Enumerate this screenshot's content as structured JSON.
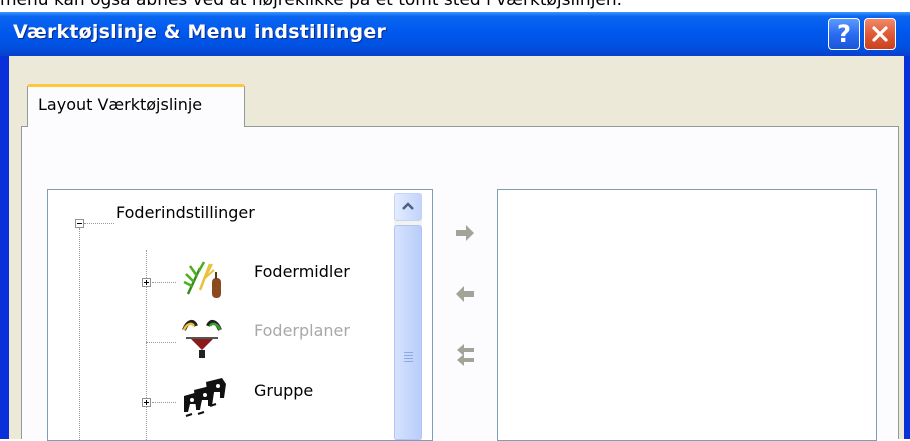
{
  "caption": {
    "text": "menu kan også åbnes ved at højreklikke på et tomt sted i værktøjslinjen."
  },
  "window": {
    "title": "Værktøjslinje & Menu indstillinger",
    "help_label": "?",
    "close_icon": "close-x-icon",
    "titlebar_color": "#0058ee",
    "client_color": "#ece9d8"
  },
  "tabs": [
    {
      "label": "Layout Værktøjslinje",
      "active": true,
      "accent": "#ffc83c"
    }
  ],
  "tree": {
    "root": {
      "label": "Foderindstillinger",
      "expanded": true
    },
    "items": [
      {
        "label": "Fodermidler",
        "icon": "fodermidler-icon",
        "expandable": true,
        "enabled": true
      },
      {
        "label": "Foderplaner",
        "icon": "foderplaner-icon",
        "expandable": false,
        "enabled": false
      },
      {
        "label": "Gruppe",
        "icon": "gruppe-icon",
        "expandable": true,
        "enabled": true
      }
    ]
  },
  "transfer_buttons": [
    {
      "name": "add-right-arrow",
      "icon": "arrow-right-icon"
    },
    {
      "name": "remove-left-arrow",
      "icon": "arrow-left-icon"
    },
    {
      "name": "remove-all-arrow",
      "icon": "double-arrow-left-icon"
    }
  ],
  "target_list": {
    "items": []
  }
}
